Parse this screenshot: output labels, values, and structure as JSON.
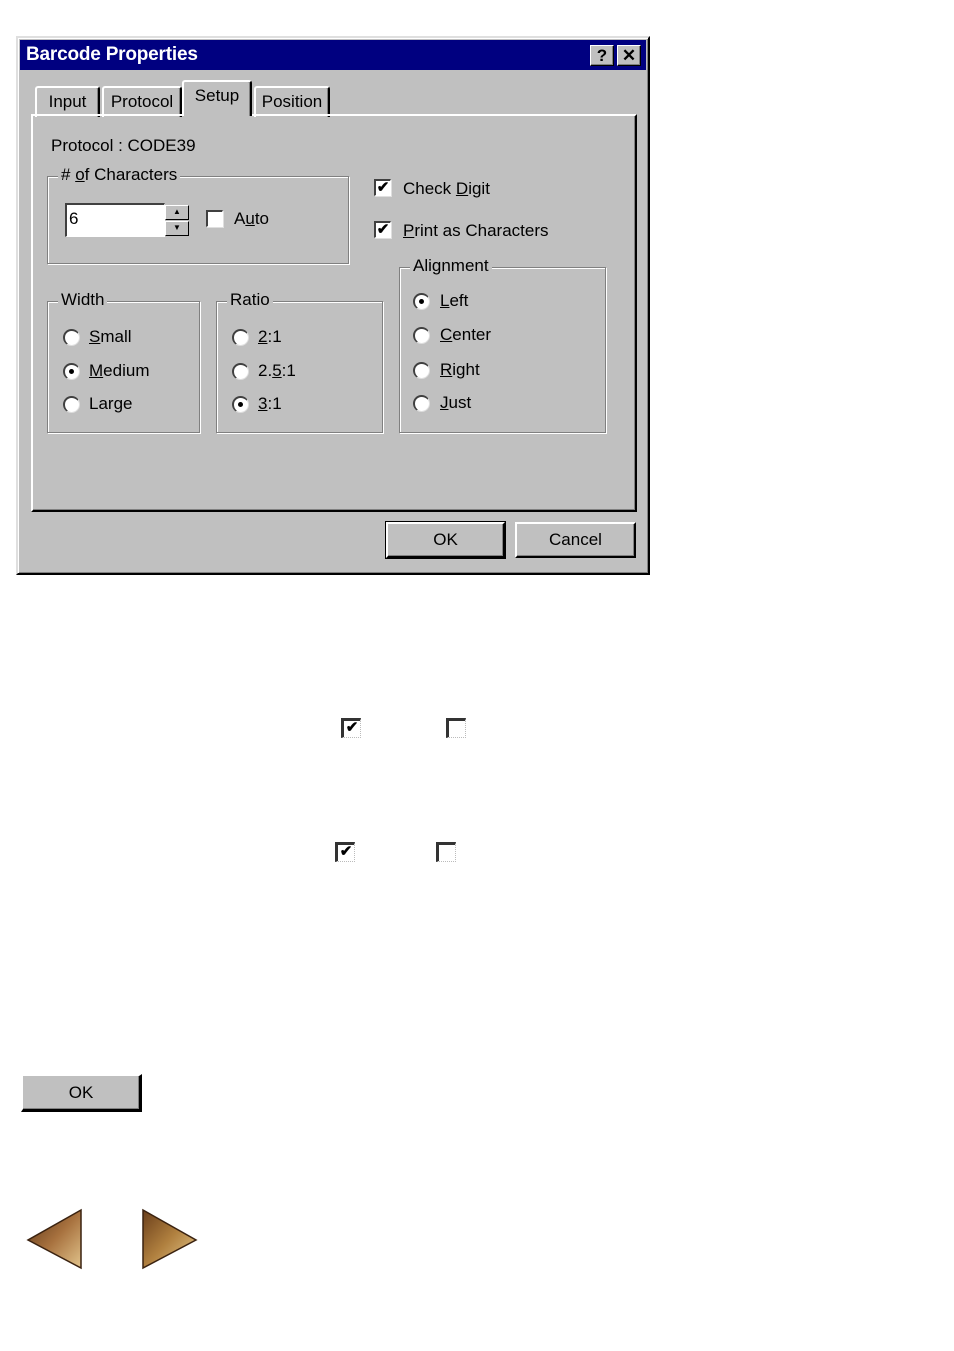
{
  "dialog": {
    "title": "Barcode Properties",
    "help_button": "?",
    "close_button": "✕",
    "tabs": [
      {
        "label": "Input",
        "active": false
      },
      {
        "label": "Protocol",
        "active": false
      },
      {
        "label": "Setup",
        "active": true
      },
      {
        "label": "Position",
        "active": false
      }
    ],
    "protocol_label": "Protocol : CODE39",
    "characters_group": {
      "legend_prefix": "# ",
      "legend_underlined": "o",
      "legend_rest": "f Characters",
      "value": "6",
      "auto": {
        "label_pre": "A",
        "label_u": "u",
        "label_post": "to",
        "checked": false
      }
    },
    "check_digit": {
      "label_pre": "Check ",
      "label_u": "D",
      "label_post": "igit",
      "checked": true,
      "mark": "✔"
    },
    "print_as_characters": {
      "label_pre": "",
      "label_u": "P",
      "label_post": "rint as Characters",
      "checked": true,
      "mark": "✔"
    },
    "width_group": {
      "legend": "Width",
      "options": [
        {
          "label_pre": "",
          "label_u": "S",
          "label_post": "mall",
          "selected": false
        },
        {
          "label_pre": "",
          "label_u": "M",
          "label_post": "edium",
          "selected": true
        },
        {
          "label_pre": "Large",
          "label_u": "",
          "label_post": "",
          "selected": false
        }
      ]
    },
    "ratio_group": {
      "legend": "Ratio",
      "options": [
        {
          "label_pre": "",
          "label_u": "2",
          "label_post": ":1",
          "selected": false
        },
        {
          "label_pre": "2.",
          "label_u": "5",
          "label_post": ":1",
          "selected": false
        },
        {
          "label_pre": "",
          "label_u": "3",
          "label_post": ":1",
          "selected": true
        }
      ]
    },
    "alignment_group": {
      "legend": "Alignment",
      "options": [
        {
          "label_pre": "",
          "label_u": "L",
          "label_post": "eft",
          "selected": true
        },
        {
          "label_pre": "",
          "label_u": "C",
          "label_post": "enter",
          "selected": false
        },
        {
          "label_pre": "",
          "label_u": "R",
          "label_post": "ight",
          "selected": false
        },
        {
          "label_pre": "",
          "label_u": "J",
          "label_post": "ust",
          "selected": false
        }
      ]
    },
    "ok_button": "OK",
    "cancel_button": "Cancel"
  },
  "legend_icons": {
    "row1": {
      "checked_mark": "✔",
      "unchecked_mark": ""
    },
    "row2": {
      "checked_mark": "✔",
      "unchecked_mark": ""
    }
  },
  "standalone_ok_button": "OK",
  "navigation": {
    "previous": "previous-page-arrow",
    "next": "next-page-arrow",
    "arrow_color": "#8b5a2b"
  }
}
